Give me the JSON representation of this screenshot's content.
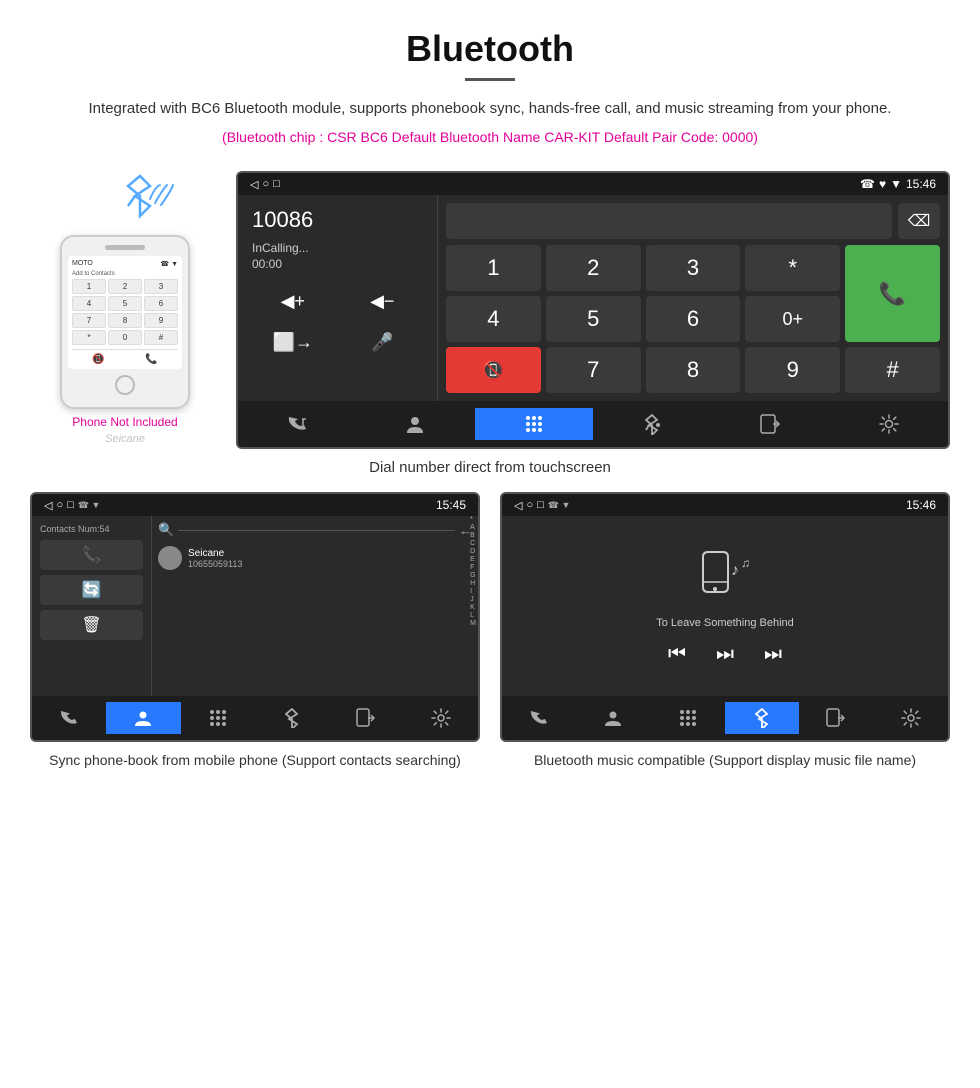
{
  "header": {
    "title": "Bluetooth",
    "description": "Integrated with BC6 Bluetooth module, supports phonebook sync, hands-free call, and music streaming from your phone.",
    "specs": "(Bluetooth chip : CSR BC6    Default Bluetooth Name CAR-KIT    Default Pair Code: 0000)"
  },
  "dial_screen": {
    "status_bar": {
      "left_icons": "◁  ○  □",
      "right_icons": "☎ ♥ ▼ 15:46"
    },
    "number": "10086",
    "in_calling": "InCalling...",
    "timer": "00:00",
    "keys": [
      "1",
      "2",
      "3",
      "*",
      "4",
      "5",
      "6",
      "0+",
      "7",
      "8",
      "9",
      "#"
    ],
    "call_icon": "📞",
    "end_icon": "📵",
    "nav_items": [
      "⇄☎",
      "👤",
      "⋮⋮⋮",
      "⚡",
      "↗",
      "⚙"
    ]
  },
  "caption_main": "Dial number direct from touchscreen",
  "phone_not_included": "Phone Not Included",
  "phone_mock": {
    "contacts_label": "Add to Contacts",
    "dial_keys": [
      "1",
      "2",
      "3",
      "4",
      "5",
      "6",
      "7",
      "8",
      "9",
      "*",
      "0",
      "#"
    ],
    "bottom_icons": [
      "☎",
      "📞"
    ]
  },
  "contacts_screen": {
    "status_bar": "◁  ○  □  ☎♥▼ 15:45",
    "contacts_num": "Contacts Num:54",
    "search_placeholder": "Search",
    "contact_name": "Seicane",
    "contact_number": "10655059113",
    "alphabet": [
      "*",
      "A",
      "B",
      "C",
      "D",
      "E",
      "F",
      "G",
      "H",
      "I",
      "J",
      "K",
      "L",
      "M"
    ],
    "nav_items": [
      "⇄☎",
      "👤",
      "⋮⋮⋮",
      "⚡",
      "↗",
      "⚙"
    ]
  },
  "music_screen": {
    "status_bar": "◁  ○  □  ☎♥▼ 15:46",
    "song_title": "To Leave Something Behind",
    "controls": [
      "⏮",
      "⏭",
      "⏭"
    ],
    "nav_items": [
      "⇄☎",
      "👤",
      "⋮⋮⋮",
      "⚡",
      "↗",
      "⚙"
    ]
  },
  "caption_contacts": "Sync phone-book from mobile phone\n(Support contacts searching)",
  "caption_music": "Bluetooth music compatible\n(Support display music file name)",
  "seicane_watermark": "Seicane"
}
